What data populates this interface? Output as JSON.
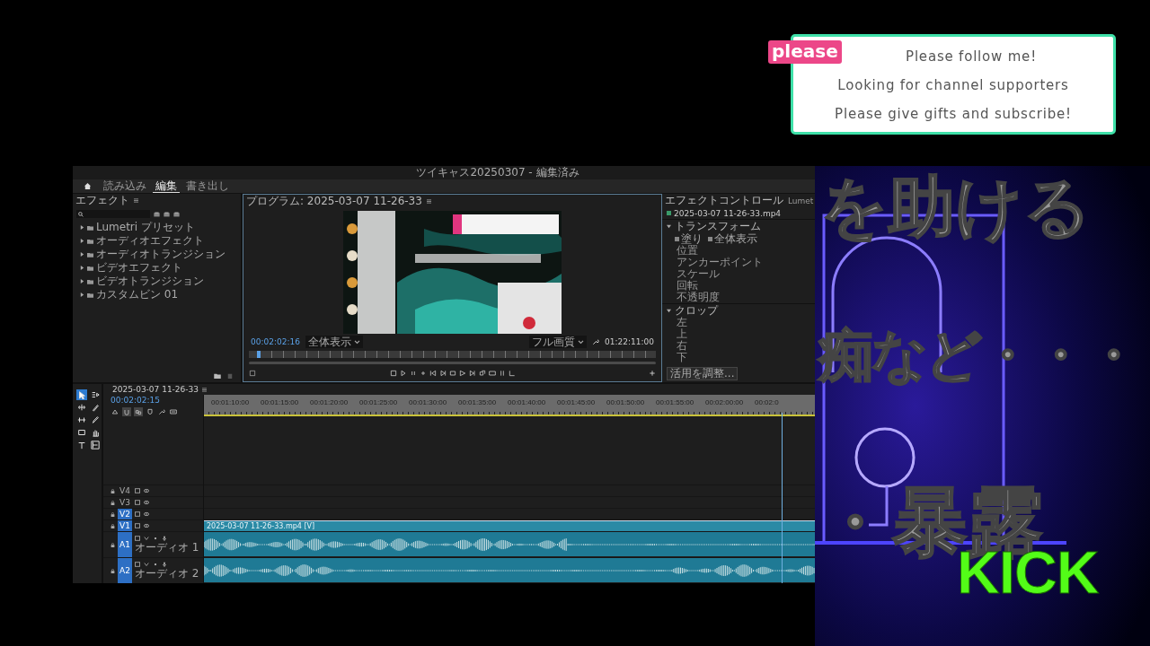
{
  "overlay_card": {
    "badge": "please",
    "lines": [
      "Please follow me!",
      "Looking for channel supporters",
      "Please give gifts and subscribe!"
    ]
  },
  "editor": {
    "title": "ツイキャス20250307 - 編集済み",
    "workspace_tabs": [
      {
        "label": "読み込み",
        "selected": false
      },
      {
        "label": "編集",
        "selected": true
      },
      {
        "label": "書き出し",
        "selected": false
      }
    ],
    "effects_panel": {
      "title": "エフェクト",
      "items": [
        {
          "label": "Lumetri プリセット",
          "expanded": false
        },
        {
          "label": "オーディオエフェクト",
          "expanded": false
        },
        {
          "label": "オーディオトランジション",
          "expanded": false
        },
        {
          "label": "ビデオエフェクト",
          "expanded": false
        },
        {
          "label": "ビデオトランジション",
          "expanded": false
        },
        {
          "label": "カスタムビン 01",
          "expanded": false
        }
      ]
    },
    "program_monitor": {
      "title": "プログラム: 2025-03-07 11-26-33",
      "timecode": "00:02:02:16",
      "zoom": "全体表示",
      "quality": "フル画質",
      "duration": "01:22:11:00",
      "playhead": {
        "level": 0.02
      }
    },
    "effect_controls": {
      "title": "エフェクトコントロール",
      "tab_2": "Lumet",
      "clip": "2025-03-07 11-26-33.mp4",
      "sections": [
        {
          "label": "トランスフォーム",
          "expanded": true,
          "options": [
            "塗り",
            "全体表示"
          ],
          "properties": [
            "位置",
            "アンカーポイント",
            "スケール",
            "回転",
            "不透明度"
          ]
        },
        {
          "label": "クロップ",
          "expanded": true,
          "properties": [
            "左",
            "上",
            "右",
            "下"
          ]
        }
      ],
      "button": "活用を調整..."
    },
    "timeline": {
      "title": "2025-03-07 11-26-33",
      "timecode": "00:02:02:15",
      "tools": [
        {
          "kind": "pointer",
          "selected": true
        },
        {
          "kind": "track",
          "selected": false
        },
        {
          "kind": "ripple",
          "selected": false
        },
        {
          "kind": "razor",
          "selected": false
        },
        {
          "kind": "slip",
          "selected": false
        },
        {
          "kind": "pen",
          "selected": false
        },
        {
          "kind": "rect",
          "selected": false
        },
        {
          "kind": "hand",
          "selected": false
        },
        {
          "kind": "type",
          "selected": false
        },
        {
          "kind": "vtype",
          "selected": false
        }
      ],
      "toggles": [
        {
          "kind": "nest",
          "on": false
        },
        {
          "kind": "snap",
          "on": true
        },
        {
          "kind": "link",
          "on": true
        },
        {
          "kind": "marker",
          "on": false
        },
        {
          "kind": "wrench",
          "on": false
        },
        {
          "kind": "caption",
          "on": false
        }
      ],
      "ruler": [
        "00:01:10:00",
        "00:01:15:00",
        "00:01:20:00",
        "00:01:25:00",
        "00:01:30:00",
        "00:01:35:00",
        "00:01:40:00",
        "00:01:45:00",
        "00:01:50:00",
        "00:01:55:00",
        "00:02:00:00",
        "00:02:0"
      ],
      "playhead": {
        "level": 0.945
      },
      "tracks": [
        {
          "kind": "video",
          "name": "V4",
          "targeted": false
        },
        {
          "kind": "video",
          "name": "V3",
          "targeted": false
        },
        {
          "kind": "video",
          "name": "V2",
          "targeted": true
        },
        {
          "kind": "video",
          "name": "V1",
          "targeted": true,
          "clip": "2025-03-07 11-26-33.mp4 [V]"
        },
        {
          "kind": "audio",
          "name": "A1",
          "label": "オーディオ 1",
          "targeted": true
        },
        {
          "kind": "audio",
          "name": "A2",
          "label": "オーディオ 2",
          "targeted": true
        }
      ]
    }
  },
  "background_text": [
    "を助ける",
    "痴など・・・",
    "・暴露"
  ],
  "logo": "KICK"
}
